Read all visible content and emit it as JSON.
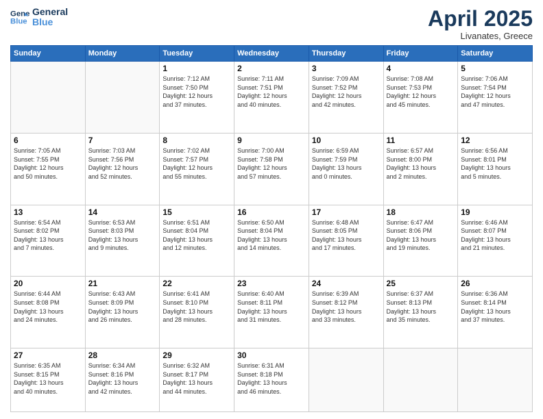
{
  "logo": {
    "line1": "General",
    "line2": "Blue"
  },
  "title": "April 2025",
  "location": "Livanates, Greece",
  "weekdays": [
    "Sunday",
    "Monday",
    "Tuesday",
    "Wednesday",
    "Thursday",
    "Friday",
    "Saturday"
  ],
  "days": [
    {
      "num": "",
      "info": ""
    },
    {
      "num": "",
      "info": ""
    },
    {
      "num": "1",
      "info": "Sunrise: 7:12 AM\nSunset: 7:50 PM\nDaylight: 12 hours\nand 37 minutes."
    },
    {
      "num": "2",
      "info": "Sunrise: 7:11 AM\nSunset: 7:51 PM\nDaylight: 12 hours\nand 40 minutes."
    },
    {
      "num": "3",
      "info": "Sunrise: 7:09 AM\nSunset: 7:52 PM\nDaylight: 12 hours\nand 42 minutes."
    },
    {
      "num": "4",
      "info": "Sunrise: 7:08 AM\nSunset: 7:53 PM\nDaylight: 12 hours\nand 45 minutes."
    },
    {
      "num": "5",
      "info": "Sunrise: 7:06 AM\nSunset: 7:54 PM\nDaylight: 12 hours\nand 47 minutes."
    },
    {
      "num": "6",
      "info": "Sunrise: 7:05 AM\nSunset: 7:55 PM\nDaylight: 12 hours\nand 50 minutes."
    },
    {
      "num": "7",
      "info": "Sunrise: 7:03 AM\nSunset: 7:56 PM\nDaylight: 12 hours\nand 52 minutes."
    },
    {
      "num": "8",
      "info": "Sunrise: 7:02 AM\nSunset: 7:57 PM\nDaylight: 12 hours\nand 55 minutes."
    },
    {
      "num": "9",
      "info": "Sunrise: 7:00 AM\nSunset: 7:58 PM\nDaylight: 12 hours\nand 57 minutes."
    },
    {
      "num": "10",
      "info": "Sunrise: 6:59 AM\nSunset: 7:59 PM\nDaylight: 13 hours\nand 0 minutes."
    },
    {
      "num": "11",
      "info": "Sunrise: 6:57 AM\nSunset: 8:00 PM\nDaylight: 13 hours\nand 2 minutes."
    },
    {
      "num": "12",
      "info": "Sunrise: 6:56 AM\nSunset: 8:01 PM\nDaylight: 13 hours\nand 5 minutes."
    },
    {
      "num": "13",
      "info": "Sunrise: 6:54 AM\nSunset: 8:02 PM\nDaylight: 13 hours\nand 7 minutes."
    },
    {
      "num": "14",
      "info": "Sunrise: 6:53 AM\nSunset: 8:03 PM\nDaylight: 13 hours\nand 9 minutes."
    },
    {
      "num": "15",
      "info": "Sunrise: 6:51 AM\nSunset: 8:04 PM\nDaylight: 13 hours\nand 12 minutes."
    },
    {
      "num": "16",
      "info": "Sunrise: 6:50 AM\nSunset: 8:04 PM\nDaylight: 13 hours\nand 14 minutes."
    },
    {
      "num": "17",
      "info": "Sunrise: 6:48 AM\nSunset: 8:05 PM\nDaylight: 13 hours\nand 17 minutes."
    },
    {
      "num": "18",
      "info": "Sunrise: 6:47 AM\nSunset: 8:06 PM\nDaylight: 13 hours\nand 19 minutes."
    },
    {
      "num": "19",
      "info": "Sunrise: 6:46 AM\nSunset: 8:07 PM\nDaylight: 13 hours\nand 21 minutes."
    },
    {
      "num": "20",
      "info": "Sunrise: 6:44 AM\nSunset: 8:08 PM\nDaylight: 13 hours\nand 24 minutes."
    },
    {
      "num": "21",
      "info": "Sunrise: 6:43 AM\nSunset: 8:09 PM\nDaylight: 13 hours\nand 26 minutes."
    },
    {
      "num": "22",
      "info": "Sunrise: 6:41 AM\nSunset: 8:10 PM\nDaylight: 13 hours\nand 28 minutes."
    },
    {
      "num": "23",
      "info": "Sunrise: 6:40 AM\nSunset: 8:11 PM\nDaylight: 13 hours\nand 31 minutes."
    },
    {
      "num": "24",
      "info": "Sunrise: 6:39 AM\nSunset: 8:12 PM\nDaylight: 13 hours\nand 33 minutes."
    },
    {
      "num": "25",
      "info": "Sunrise: 6:37 AM\nSunset: 8:13 PM\nDaylight: 13 hours\nand 35 minutes."
    },
    {
      "num": "26",
      "info": "Sunrise: 6:36 AM\nSunset: 8:14 PM\nDaylight: 13 hours\nand 37 minutes."
    },
    {
      "num": "27",
      "info": "Sunrise: 6:35 AM\nSunset: 8:15 PM\nDaylight: 13 hours\nand 40 minutes."
    },
    {
      "num": "28",
      "info": "Sunrise: 6:34 AM\nSunset: 8:16 PM\nDaylight: 13 hours\nand 42 minutes."
    },
    {
      "num": "29",
      "info": "Sunrise: 6:32 AM\nSunset: 8:17 PM\nDaylight: 13 hours\nand 44 minutes."
    },
    {
      "num": "30",
      "info": "Sunrise: 6:31 AM\nSunset: 8:18 PM\nDaylight: 13 hours\nand 46 minutes."
    },
    {
      "num": "",
      "info": ""
    },
    {
      "num": "",
      "info": ""
    },
    {
      "num": "",
      "info": ""
    }
  ]
}
